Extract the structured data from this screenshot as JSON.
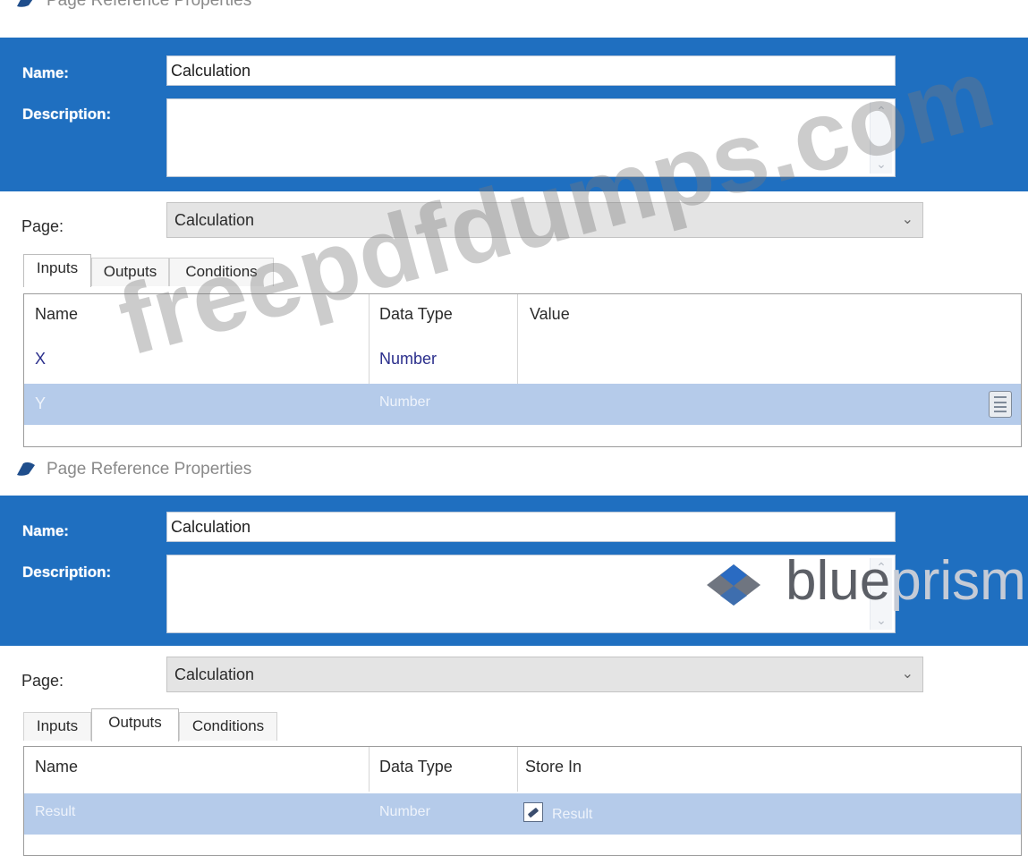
{
  "panels": [
    {
      "title": "Page Reference Properties",
      "name_label": "Name:",
      "name_value": "Calculation",
      "description_label": "Description:",
      "description_value": "",
      "page_label": "Page:",
      "page_value": "Calculation",
      "tabs": [
        "Inputs",
        "Outputs",
        "Conditions"
      ],
      "active_tab": "Inputs",
      "grid": {
        "columns": [
          "Name",
          "Data Type",
          "Value"
        ],
        "rows": [
          {
            "name": "X",
            "data_type": "Number",
            "value": "",
            "selected": false
          },
          {
            "name": "Y",
            "data_type": "Number",
            "value": "",
            "selected": true
          }
        ]
      }
    },
    {
      "title": "Page Reference Properties",
      "name_label": "Name:",
      "name_value": "Calculation",
      "description_label": "Description:",
      "description_value": "",
      "page_label": "Page:",
      "page_value": "Calculation",
      "tabs": [
        "Inputs",
        "Outputs",
        "Conditions"
      ],
      "active_tab": "Outputs",
      "grid": {
        "columns": [
          "Name",
          "Data Type",
          "Store In"
        ],
        "rows": [
          {
            "name": "Result",
            "data_type": "Number",
            "store_in": "Result",
            "selected": true
          }
        ]
      }
    }
  ],
  "watermark": "freepdfdumps.com",
  "logo": {
    "word": "blue",
    "faded": "prism"
  },
  "colors": {
    "header_band": "#1f6fc0",
    "selected_row": "#b5cbea",
    "value_text": "#2b2f8c"
  },
  "icons": {
    "title": "page-reference-icon",
    "value_editor": "calculator-icon",
    "store_in": "data-item-icon",
    "dropdown": "chevron-down-icon"
  }
}
